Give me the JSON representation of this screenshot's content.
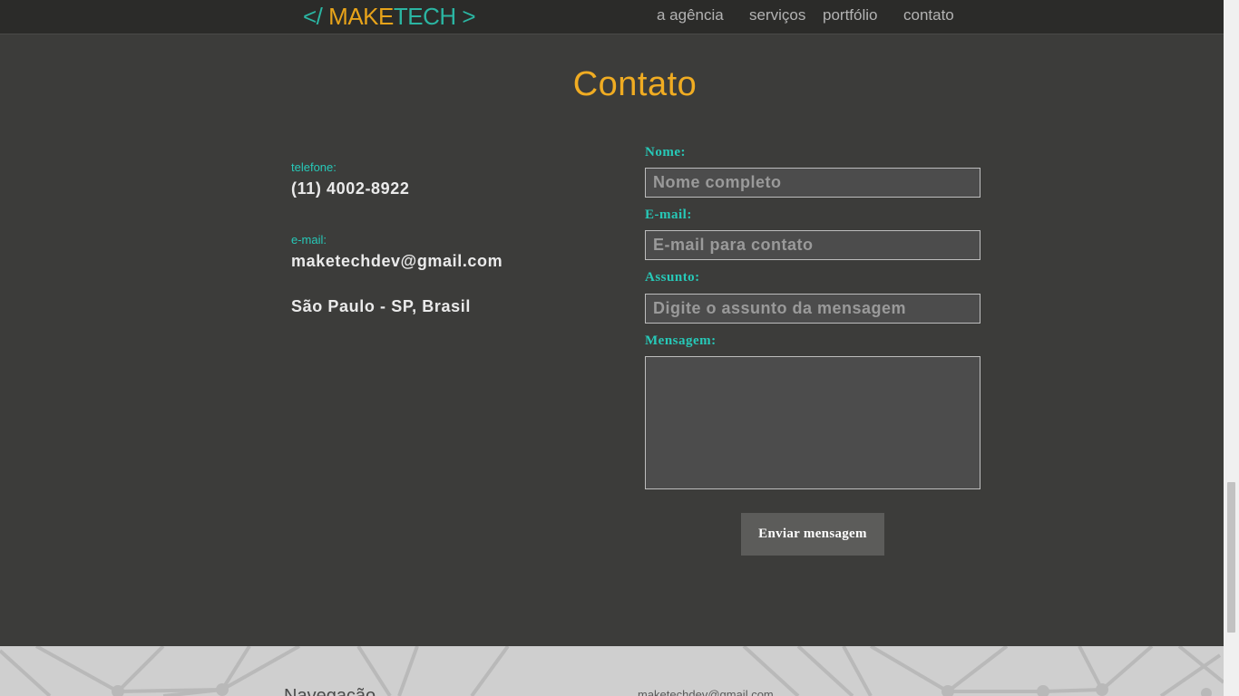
{
  "header": {
    "logo": {
      "open": "</",
      "make": "MAKE",
      "tech": "TECH",
      "close": ">"
    },
    "nav": [
      "a agência",
      "serviços",
      "portfólio",
      "contato"
    ]
  },
  "contact": {
    "title": "Contato",
    "phone_label": "telefone:",
    "phone": "(11) 4002-8922",
    "email_label": "e-mail:",
    "email": "maketechdev@gmail.com",
    "location": "São Paulo - SP, Brasil"
  },
  "form": {
    "name_label": "Nome:",
    "name_placeholder": "Nome completo",
    "email_label": "E-mail:",
    "email_placeholder": "E-mail para contato",
    "subject_label": "Assunto:",
    "subject_placeholder": "Digite o assunto da mensagem",
    "message_label": "Mensagem:",
    "submit_label": "Enviar mensagem"
  },
  "footer": {
    "nav_heading": "Navegação",
    "email": "maketechdev@gmail.com"
  },
  "colors": {
    "background": "#3c3c3a",
    "accent_orange": "#f0ac22",
    "accent_teal": "#27c9b8",
    "header": "#2b2b29"
  }
}
